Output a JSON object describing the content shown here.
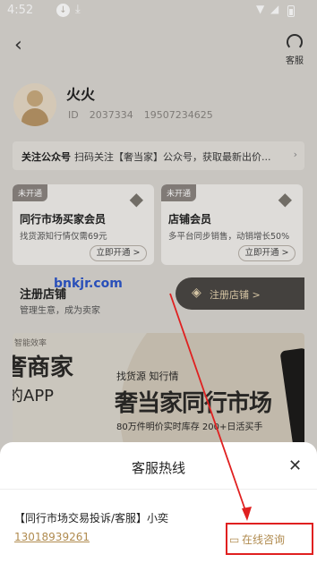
{
  "status": {
    "time": "4:52"
  },
  "header": {
    "customer_service_label": "客服"
  },
  "user": {
    "name": "火火",
    "id_label": "ID",
    "id": "2037334",
    "phone": "19507234625"
  },
  "follow_bar": {
    "title": "关注公众号",
    "text": "扫码关注【奢当家】公众号，获取最新出价..."
  },
  "membership": [
    {
      "tag": "未开通",
      "title": "同行市场买家会员",
      "sub": "找货源知行情仅需69元",
      "button": "立即开通 >"
    },
    {
      "tag": "未开通",
      "title": "店铺会员",
      "sub": "多平台同步销售，动销增长50%",
      "button": "立即开通 >"
    }
  ],
  "watermark": "bnkjr.com",
  "register": {
    "title": "注册店铺",
    "subtitle": "管理生意，成为卖家",
    "button": "注册店铺 >"
  },
  "banner": {
    "label": "智能效率",
    "line1": "奢商家",
    "line2": "的APP",
    "tagline": "找货源   知行情",
    "headline": "奢当家同行市场",
    "detail": "80万件明价实时库存  200+日活买手"
  },
  "sheet": {
    "title": "客服热线",
    "department": "【同行市场交易投诉/客服】小奕",
    "phone": "13018939261",
    "online_button": "在线咨询"
  },
  "colors": {
    "accent": "#b08b4f",
    "highlight": "#e02020"
  }
}
